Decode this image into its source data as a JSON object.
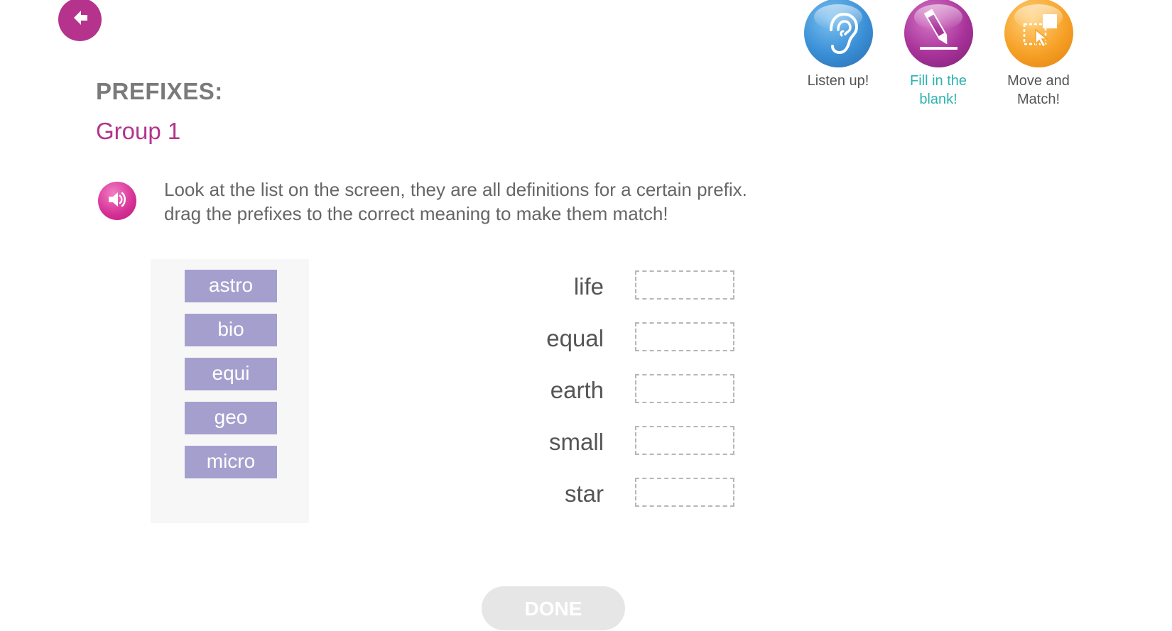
{
  "header": {
    "back_icon": "arrow-left-icon",
    "modes": [
      {
        "label_line1": "Listen up!",
        "label_line2": "",
        "icon": "ear-icon",
        "color": "#3a8fd6",
        "active": false
      },
      {
        "label_line1": "Fill in the",
        "label_line2": "blank!",
        "icon": "pencil-icon",
        "color": "#a8339a",
        "active": true
      },
      {
        "label_line1": "Move and",
        "label_line2": "Match!",
        "icon": "drag-select-icon",
        "color": "#f6a127",
        "active": false
      }
    ]
  },
  "lesson": {
    "title": "PREFIXES:",
    "group": "Group 1",
    "speaker_icon": "speaker-icon",
    "instruction_line1": "Look at the list on the screen, they are all definitions for a certain prefix.",
    "instruction_line2": "drag the prefixes to the correct meaning to make them match!"
  },
  "prefixes": [
    "astro",
    "bio",
    "equi",
    "geo",
    "micro"
  ],
  "meanings": [
    "life",
    "equal",
    "earth",
    "small",
    "star"
  ],
  "slots": [
    "",
    "",
    "",
    "",
    ""
  ],
  "done_label": "DONE",
  "colors": {
    "accent": "#b5338c",
    "chip": "#a59fce",
    "active_mode": "#2cb3b0",
    "done_disabled": "#e6e6e6"
  }
}
